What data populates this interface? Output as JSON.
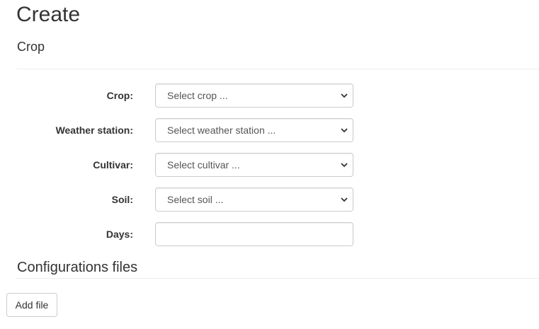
{
  "page": {
    "title": "Create",
    "subtitle": "Crop"
  },
  "form": {
    "fields": [
      {
        "label": "Crop:",
        "type": "select",
        "value": "Select crop ..."
      },
      {
        "label": "Weather station:",
        "type": "select",
        "value": "Select weather station ..."
      },
      {
        "label": "Cultivar:",
        "type": "select",
        "value": "Select cultivar ..."
      },
      {
        "label": "Soil:",
        "type": "select",
        "value": "Select soil ..."
      },
      {
        "label": "Days:",
        "type": "text",
        "value": ""
      }
    ]
  },
  "config_section": {
    "heading": "Configurations files",
    "add_button_label": "Add file"
  },
  "icons": {
    "select_arrow": "chevron-down-icon"
  }
}
